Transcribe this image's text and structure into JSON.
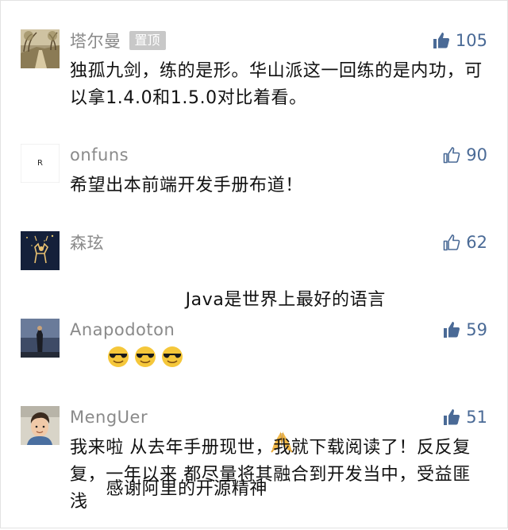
{
  "comments": [
    {
      "name": "塔尔曼",
      "badge": "置顶",
      "likes": "105",
      "liked": true,
      "text": "独孤九剑，练的是形。华山派这一回练的是内功，可以拿1.4.0和1.5.0对比着看。"
    },
    {
      "name": "onfuns",
      "likes": "90",
      "liked": false,
      "avatar_letter": "R",
      "text": "希望出本前端开发手册布道！"
    },
    {
      "name": "森玹",
      "likes": "62",
      "liked": false,
      "text": "Java是世界上最好的语言"
    },
    {
      "name": "Anapodoton",
      "likes": "59",
      "liked": true,
      "text": "感谢阿里的开源精神"
    },
    {
      "name": "MengUer",
      "likes": "51",
      "liked": true,
      "text": "我来啦 从去年手册现世，我就下载阅读了！反反复复，一年以来 都尽量将其融合到开发当中，受益匪浅"
    }
  ],
  "colors": {
    "name": "#8a8a8a",
    "like_count": "#4a6a96",
    "like_icon": "#4a6a96",
    "badge_bg": "#c8c8c8",
    "text": "#111111"
  },
  "icons": {
    "like_filled": "thumbs-up-filled-icon",
    "like_outline": "thumbs-up-outline-icon",
    "cool_emoji": "sunglasses-face-emoji",
    "pray_emoji": "folded-hands-emoji"
  }
}
